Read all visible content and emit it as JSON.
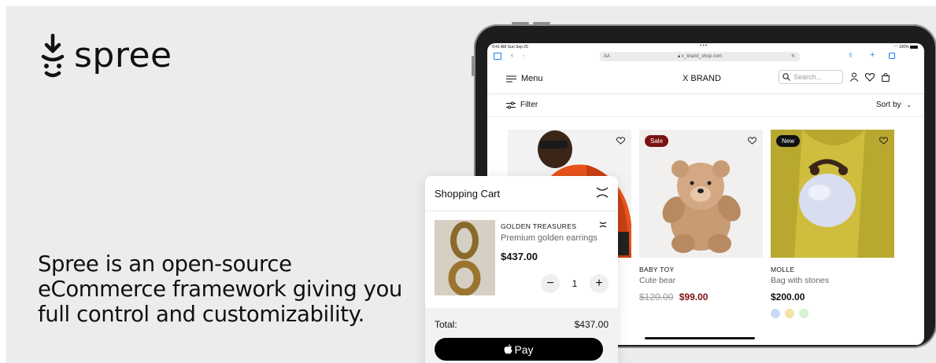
{
  "logo": {
    "text": "spree",
    "icon": "spree-logo-icon"
  },
  "tagline": "Spree is an open-source eCommerce framework giving you full control and customizability.",
  "device": {
    "status": {
      "time": "9:41 AM  Sun Sep 25",
      "dots": "•••",
      "battery": "100%"
    },
    "safari": {
      "url": "x_brand_shop.com",
      "text_size": "AA"
    },
    "header": {
      "menu_label": "Menu",
      "brand": "X BRAND",
      "search_placeholder": "Search..."
    },
    "filter": {
      "filter_label": "Filter",
      "sort_label": "Sort by"
    },
    "products": [
      {
        "title": "",
        "desc": "",
        "price": "",
        "badge": ""
      },
      {
        "title": "BABY TOY",
        "desc": "Cute bear",
        "old_price": "$120.00",
        "price": "$99.00",
        "badge": "Sale"
      },
      {
        "title": "MOLLE",
        "desc": "Bag with stones",
        "price": "$200.00",
        "badge": "New"
      }
    ],
    "swatch_colors": [
      "#c9d8f5",
      "#f5e3a6",
      "#d9efd6"
    ]
  },
  "cart": {
    "title": "Shopping Cart",
    "item": {
      "name": "GOLDEN TREASURES",
      "desc": "Premium golden earrings",
      "price": "$437.00",
      "qty": "1"
    },
    "total_label": "Total:",
    "total_value": "$437.00",
    "pay_label": "Pay"
  },
  "colors": {
    "sale": "#7a1212",
    "badge_new": "#111111",
    "accent": "#000000"
  }
}
